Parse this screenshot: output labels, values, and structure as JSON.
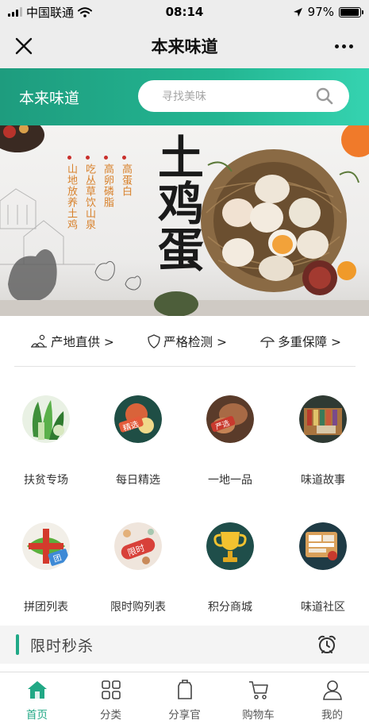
{
  "status_bar": {
    "carrier": "中国联通",
    "time": "08:14",
    "battery": "97%",
    "battery_level": 0.97
  },
  "nav": {
    "title": "本来味道"
  },
  "header": {
    "brand": "本来味道",
    "search_placeholder": "寻找美味"
  },
  "banner": {
    "title": "土鸡蛋",
    "columns": [
      "高蛋白",
      "高卵磷脂",
      "吃丛草饮山泉",
      "山地放养土鸡"
    ]
  },
  "features": [
    {
      "label": "产地直供 >",
      "icon": "farm-icon"
    },
    {
      "label": "严格检测 >",
      "icon": "shield-icon"
    },
    {
      "label": "多重保障 >",
      "icon": "umbrella-icon"
    }
  ],
  "categories": [
    {
      "label": "扶贫专场",
      "icon": "vegetables-icon"
    },
    {
      "label": "每日精选",
      "icon": "daily-pick-icon"
    },
    {
      "label": "一地一品",
      "icon": "local-product-icon"
    },
    {
      "label": "味道故事",
      "icon": "books-icon"
    },
    {
      "label": "拼团列表",
      "icon": "gift-group-icon"
    },
    {
      "label": "限时购列表",
      "icon": "limited-time-icon"
    },
    {
      "label": "积分商城",
      "icon": "trophy-icon"
    },
    {
      "label": "味道社区",
      "icon": "community-icon"
    }
  ],
  "category_badges": {
    "daily": "精选",
    "local": "严选",
    "limited": "限时",
    "group": "团"
  },
  "flash_sale": {
    "title": "限时秒杀"
  },
  "tab_bar": {
    "items": [
      {
        "label": "首页",
        "icon": "home-icon",
        "active": true
      },
      {
        "label": "分类",
        "icon": "category-icon",
        "active": false
      },
      {
        "label": "分享官",
        "icon": "share-officer-icon",
        "active": false
      },
      {
        "label": "购物车",
        "icon": "cart-icon",
        "active": false
      },
      {
        "label": "我的",
        "icon": "profile-icon",
        "active": false
      }
    ]
  },
  "colors": {
    "accent": "#21a885",
    "header_start": "#1e9c7e",
    "header_end": "#35d3b0",
    "banner_text": "#d8812b"
  }
}
